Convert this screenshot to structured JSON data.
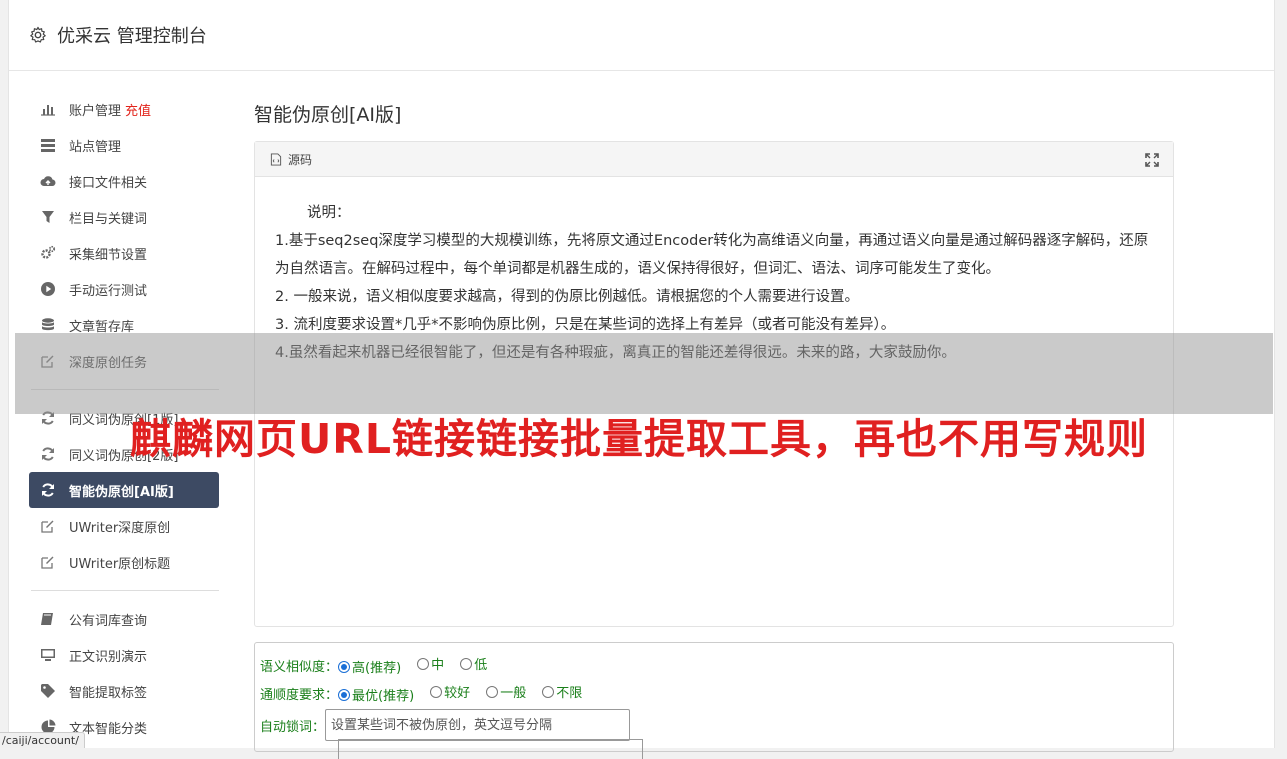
{
  "app": {
    "title": "优采云 管理控制台"
  },
  "sidebar": {
    "group1": [
      {
        "icon": "bar-chart-icon",
        "label": "账户管理",
        "extra": "充值"
      },
      {
        "icon": "server-list-icon",
        "label": "站点管理"
      },
      {
        "icon": "cloud-upload-icon",
        "label": "接口文件相关"
      },
      {
        "icon": "filter-icon",
        "label": "栏目与关键词"
      },
      {
        "icon": "gears-icon",
        "label": "采集细节设置"
      },
      {
        "icon": "play-circle-icon",
        "label": "手动运行测试"
      },
      {
        "icon": "database-icon",
        "label": "文章暂存库"
      },
      {
        "icon": "edit-icon",
        "label": "深度原创任务"
      }
    ],
    "group2": [
      {
        "icon": "refresh-icon",
        "label": "同义词伪原创[1版]"
      },
      {
        "icon": "refresh-icon",
        "label": "同义词伪原创[2版]"
      },
      {
        "icon": "refresh-icon",
        "label": "智能伪原创[AI版]",
        "active": true
      },
      {
        "icon": "edit-icon",
        "label": "UWriter深度原创"
      },
      {
        "icon": "edit-icon",
        "label": "UWriter原创标题"
      }
    ],
    "group3": [
      {
        "icon": "book-icon",
        "label": "公有词库查询"
      },
      {
        "icon": "monitor-icon",
        "label": "正文识别演示"
      },
      {
        "icon": "tag-icon",
        "label": "智能提取标签"
      },
      {
        "icon": "pie-chart-icon",
        "label": "文本智能分类"
      }
    ]
  },
  "main": {
    "title": "智能伪原创[AI版]",
    "panel_label": "源码",
    "description": {
      "heading": "说明：",
      "lines": [
        "1.基于seq2seq深度学习模型的大规模训练，先将原文通过Encoder转化为高维语义向量，再通过语义向量是通过解码器逐字解码，还原为自然语言。在解码过程中，每个单词都是机器生成的，语义保持得很好，但词汇、语法、词序可能发生了变化。",
        "2. 一般来说，语义相似度要求越高，得到的伪原比例越低。请根据您的个人需要进行设置。",
        "3. 流利度要求设置*几乎*不影响伪原比例，只是在某些词的选择上有差异（或者可能没有差异）。",
        "4.虽然看起来机器已经很智能了，但还是有各种瑕疵，离真正的智能还差得很远。未来的路，大家鼓励你。"
      ]
    }
  },
  "form": {
    "similarity": {
      "label": "语义相似度：",
      "options": [
        {
          "label": "高(推荐)",
          "checked": true
        },
        {
          "label": "中",
          "checked": false
        },
        {
          "label": "低",
          "checked": false
        }
      ]
    },
    "fluency": {
      "label": "通顺度要求：",
      "options": [
        {
          "label": "最优(推荐)",
          "checked": true
        },
        {
          "label": "较好",
          "checked": false
        },
        {
          "label": "一般",
          "checked": false
        },
        {
          "label": "不限",
          "checked": false
        }
      ]
    },
    "lock_words": {
      "label": "自动锁词：",
      "placeholder": "设置某些词不被伪原创，英文逗号分隔"
    }
  },
  "watermark": {
    "text": "麒麟网页URL链接链接批量提取工具，再也不用写规则"
  },
  "status_bar": {
    "url": "/caiji/account/"
  }
}
